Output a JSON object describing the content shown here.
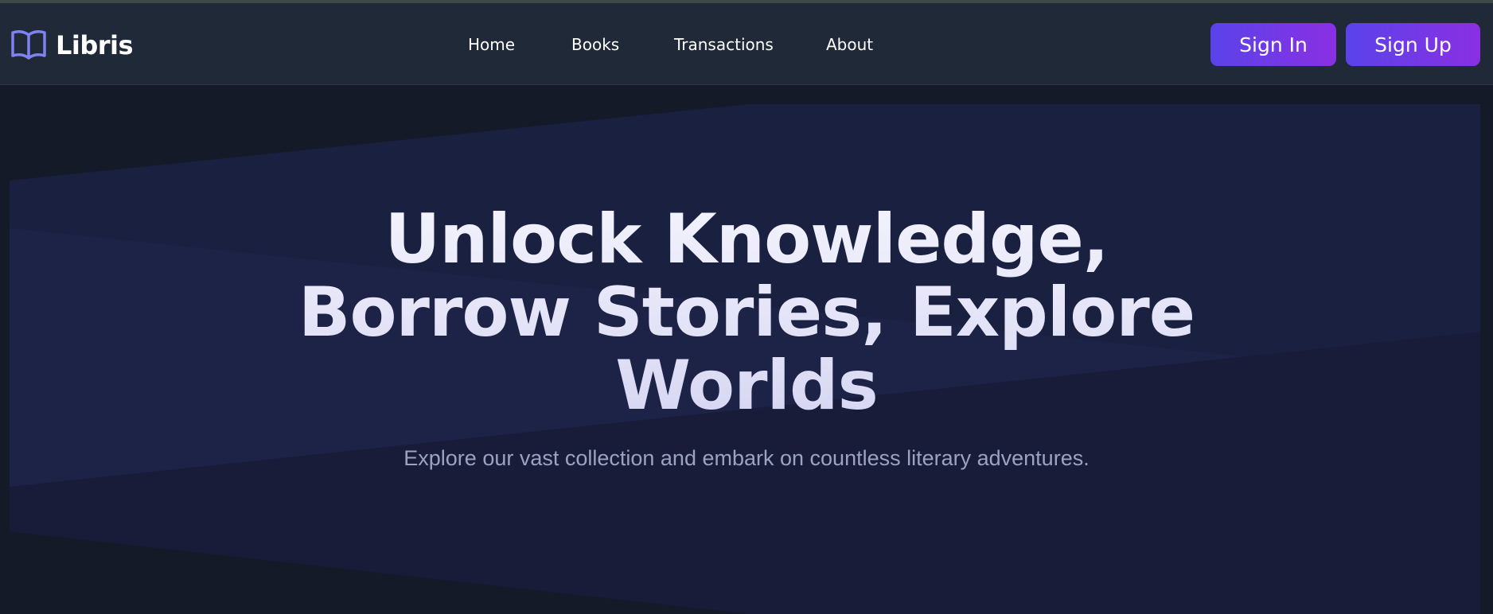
{
  "brand": {
    "name": "Libris",
    "icon": "open-book-icon"
  },
  "nav": {
    "items": [
      {
        "label": "Home"
      },
      {
        "label": "Books"
      },
      {
        "label": "Transactions"
      },
      {
        "label": "About"
      }
    ]
  },
  "auth": {
    "sign_in_label": "Sign In",
    "sign_up_label": "Sign Up"
  },
  "hero": {
    "title": "Unlock Knowledge, Borrow Stories, Explore Worlds",
    "subtitle": "Explore our vast collection and embark on countless literary adventures."
  },
  "colors": {
    "page_background": "#141a27",
    "navbar_background": "#202938",
    "accent_start": "#5a43ea",
    "accent_end": "#8a2fe3",
    "logo_icon": "#7f83ef"
  }
}
